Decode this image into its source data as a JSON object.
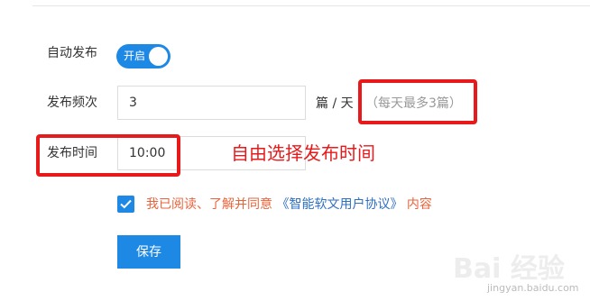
{
  "form": {
    "auto_publish_label": "自动发布",
    "auto_publish_toggle": "开启",
    "frequency_label": "发布频次",
    "frequency_value": "3",
    "frequency_unit": "篇 / 天",
    "frequency_hint": "（每天最多3篇）",
    "publish_time_label": "发布时间",
    "publish_time_value": "10:00",
    "agreement_prefix": "我已阅读、了解并同意",
    "agreement_link": "《智能软文用户协议》",
    "agreement_suffix": "内容",
    "save_label": "保存"
  },
  "annotation": {
    "text": "自由选择发布时间",
    "color": "#e8191b"
  },
  "watermark": {
    "brand": "Bai 经验",
    "url": "jingyan.baidu.com"
  },
  "colors": {
    "accent": "#1e88e5",
    "annotation_red": "#e8191b",
    "agreement_text": "#e8643c",
    "link": "#2f6fc2"
  }
}
